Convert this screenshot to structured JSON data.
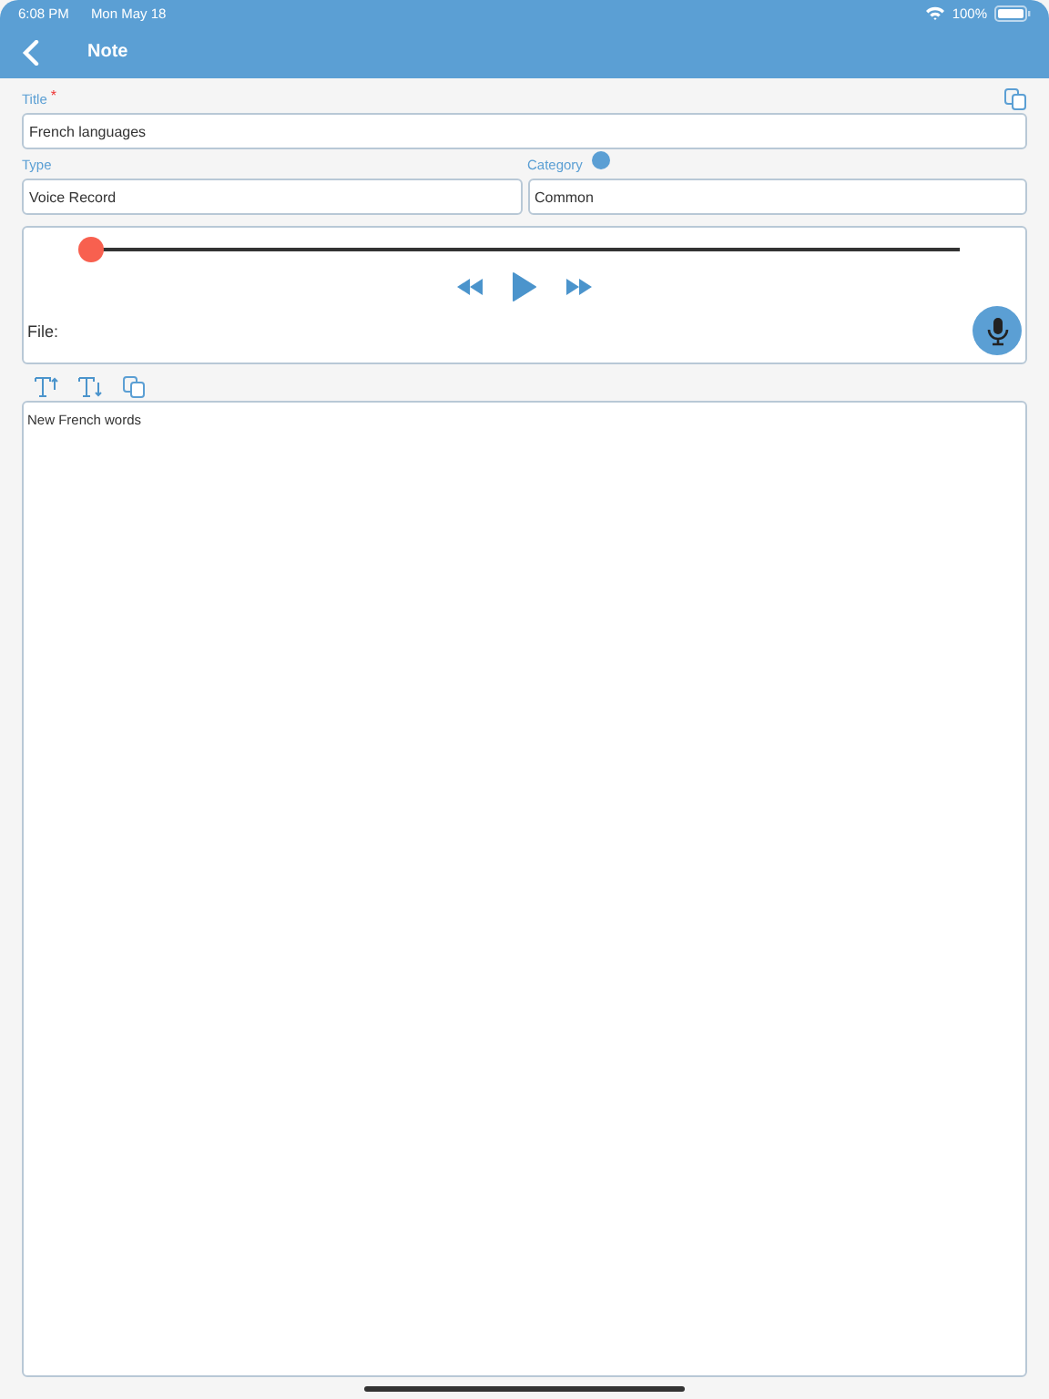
{
  "status_bar": {
    "time": "6:08 PM",
    "date": "Mon May 18",
    "battery": "100%"
  },
  "nav": {
    "title": "Note"
  },
  "title_field": {
    "label": "Title",
    "required_mark": "*",
    "value": "French languages"
  },
  "type_field": {
    "label": "Type",
    "value": "Voice Record"
  },
  "category_field": {
    "label": "Category",
    "value": "Common"
  },
  "player": {
    "level": 0,
    "file_label": "File:"
  },
  "note_text": "New French words"
}
